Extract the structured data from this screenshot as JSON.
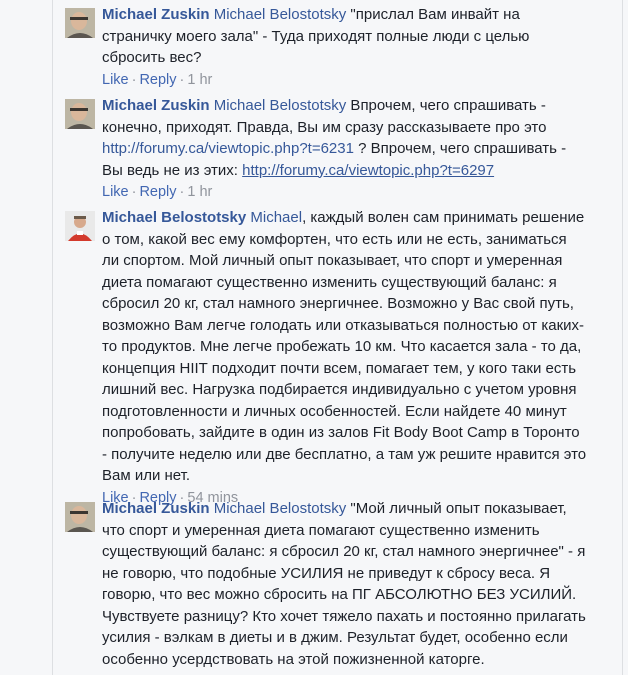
{
  "comments": [
    {
      "author": "Michael Zuskin",
      "mention": "Michael Belostotsky",
      "text": " \"прислал Вам инвайт на страничку моего зала\" - Туда приходят полные люди с целью сбросить вес?",
      "like": "Like",
      "reply": "Reply",
      "time": "1 hr"
    },
    {
      "author": "Michael Zuskin",
      "mention": "Michael Belostotsky",
      "text1": " Впрочем, чего спрашивать - конечно, приходят. Правда, Вы им сразу рассказываете про это ",
      "link1": "http://forumy.ca/viewtopic.php?t=6231",
      "text2": " ? Впрочем, чего спрашивать - Вы ведь не из этих: ",
      "link2": "http://forumy.ca/viewtopic.php?t=6297",
      "like": "Like",
      "reply": "Reply",
      "time": "1 hr"
    },
    {
      "author": "Michael Belostotsky",
      "mention": "Michael",
      "text": ", каждый волен сам принимать решение о том, какой вес ему комфортен, что есть или не есть, заниматься ли спортом. Мой личный опыт показывает, что спорт и умеренная диета помагают существенно изменить существующий баланс: я сбросил 20 кг, стал намного энергичнее. Возможно у Вас свой путь, возможно Вам легче голодать или отказываться полностью от каких-то продуктов. Мне легче пробежать 10 км. Что касается зала - то да, концепция HIIT подходит почти всем, помагает тем, у кого таки есть лишний вес. Нагрузка подбирается индивидуально с учетом уровня подготовленности и личных особенностей. Если найдете 40 минут попробовать, зайдите в один из залов Fit Body Boot Camp в Торонто - получите неделю или две бесплатно, а там уж решите нравится это Вам или нет.",
      "like": "Like",
      "reply": "Reply",
      "time": "54 mins"
    },
    {
      "author": "Michael Zuskin",
      "mention": "Michael Belostotsky",
      "text": " \"Мой личный опыт показывает, что спорт и умеренная диета помагают существенно изменить существующий баланс: я сбросил 20 кг, стал намного энергичнее\" - я не говорю, что подобные УСИЛИЯ не приведут к сбросу веса. Я говорю, что вес можно сбросить на ПГ АБСОЛЮТНО БЕЗ УСИЛИЙ. Чувствуете разницу? Кто хочет тяжело пахать и постоянно прилагать усилия - вэлкам в диеты и в джим. Результат будет, особенно если особенно усердствовать на этой пожизненной каторге."
    }
  ],
  "separator": "·",
  "options_glyph": "˙˙˙"
}
